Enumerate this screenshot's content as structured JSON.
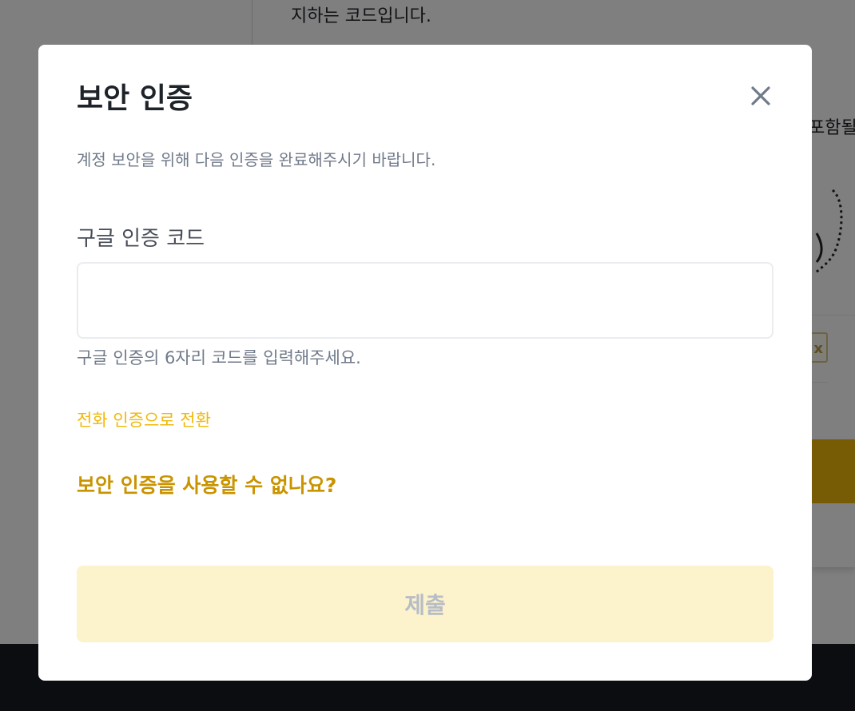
{
  "background": {
    "top_text": "지하는 코드입니다.",
    "right_text": "포함될",
    "small_box_label": "x"
  },
  "modal": {
    "title": "보안 인증",
    "close_icon": "close-icon",
    "subtitle": "계정 보안을 위해 다음 인증을 완료해주시기 바랍니다.",
    "field": {
      "label": "구글 인증 코드",
      "value": "",
      "placeholder": "",
      "hint": "구글 인증의 6자리 코드를 입력해주세요."
    },
    "switch_link": "전화 인증으로 전환",
    "help_link": "보안 인증을 사용할 수 없나요?",
    "submit_label": "제출"
  },
  "colors": {
    "brand_yellow": "#f0b90b",
    "link_gold": "#c99400",
    "submit_disabled_bg": "#fcf2cc",
    "submit_disabled_text": "#b7bdc6",
    "footer_dark": "#181a20"
  }
}
